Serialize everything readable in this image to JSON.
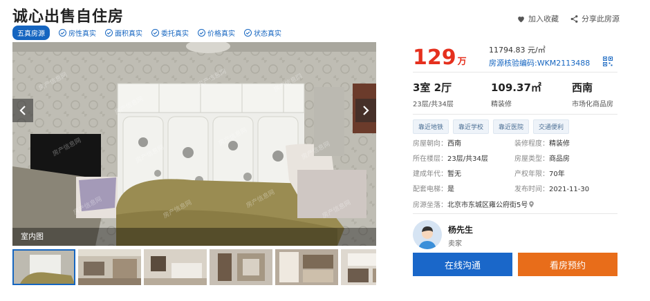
{
  "listing": {
    "title": "诚心出售自住房",
    "actions": {
      "favorite": "加入收藏",
      "share": "分享此房源"
    },
    "badge": "五真房源",
    "verify_tags": [
      "房性真实",
      "面积真实",
      "委托真实",
      "价格真实",
      "状态真实"
    ]
  },
  "gallery": {
    "caption": "室内图",
    "watermark": "房产信息网",
    "thumb_count": 6
  },
  "price": {
    "total": "129",
    "total_unit": "万",
    "unit_price": "11794.83 元/㎡",
    "verify_code": "房源核验编码:WKM2113488"
  },
  "stats": [
    {
      "value": "3室 2厅",
      "sub": "23层/共34层"
    },
    {
      "value": "109.37㎡",
      "sub": "精装修"
    },
    {
      "value": "西南",
      "sub": "市场化商品房"
    }
  ],
  "chips": [
    "靠近地铁",
    "靠近学校",
    "靠近医院",
    "交通便利"
  ],
  "details": {
    "orientation": {
      "k": "房屋朝向：",
      "v": "西南"
    },
    "decoration": {
      "k": "装修程度：",
      "v": "精装修"
    },
    "floor": {
      "k": "所在楼层：",
      "v": "23层/共34层"
    },
    "type": {
      "k": "房屋类型：",
      "v": "商品房"
    },
    "year": {
      "k": "建成年代：",
      "v": "暂无"
    },
    "tenure": {
      "k": "产权年限：",
      "v": "70年"
    },
    "elevator": {
      "k": "配套电梯：",
      "v": "是"
    },
    "published": {
      "k": "发布时间：",
      "v": "2021-11-30"
    },
    "address": {
      "k": "房源坐落：",
      "v": "北京市东城区雍公府街5号"
    }
  },
  "agent": {
    "name": "杨先生",
    "role": "卖家"
  },
  "buttons": {
    "chat": "在线沟通",
    "visit": "看房预约"
  },
  "colors": {
    "price": "#e5301e",
    "brand": "#1565c0",
    "chat": "#1a67c9",
    "visit": "#e86d1a"
  }
}
